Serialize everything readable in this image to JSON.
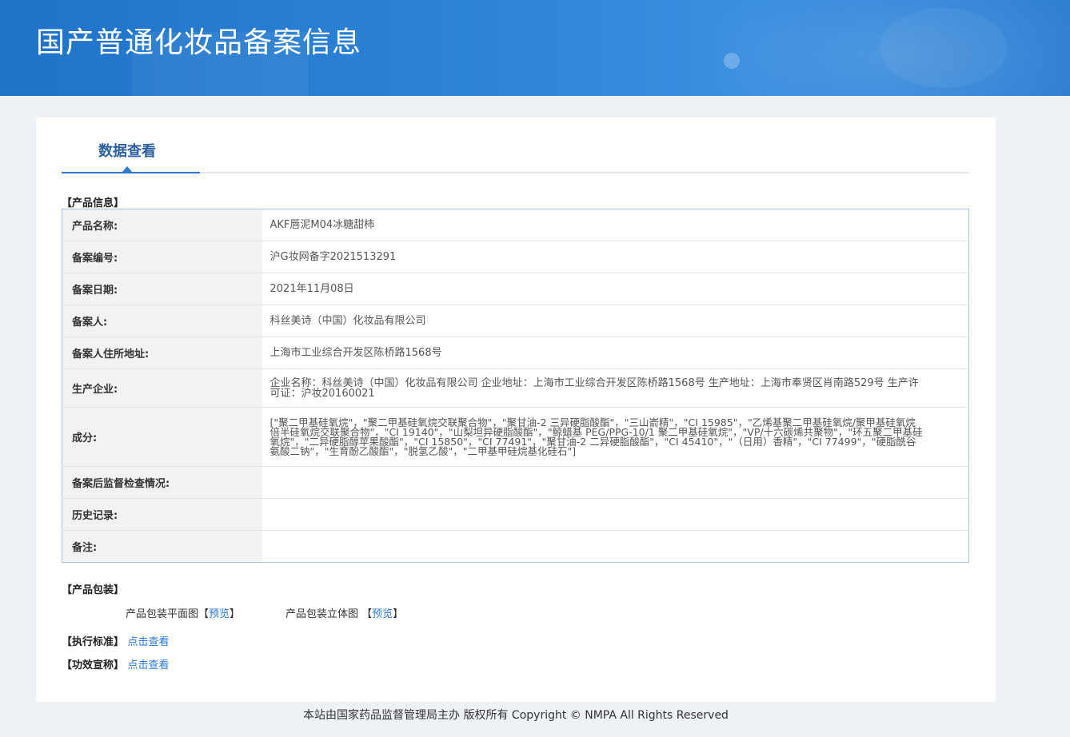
{
  "header": {
    "title": "国产普通化妆品备案信息"
  },
  "tab": {
    "label": "数据查看"
  },
  "product_info": {
    "section_title": "【产品信息】",
    "rows": [
      {
        "label": "产品名称:",
        "value": "AKF唇泥M04冰糖甜柿"
      },
      {
        "label": "备案编号:",
        "value": "沪G妆网备字2021513291"
      },
      {
        "label": "备案日期:",
        "value": "2021年11月08日"
      },
      {
        "label": "备案人:",
        "value": "科丝美诗（中国）化妆品有限公司"
      },
      {
        "label": "备案人住所地址:",
        "value": "上海市工业综合开发区陈桥路1568号"
      },
      {
        "label": "生产企业:",
        "value": "企业名称：科丝美诗（中国）化妆品有限公司 企业地址：上海市工业综合开发区陈桥路1568号 生产地址：上海市奉贤区肖南路529号 生产许可证：沪妆20160021"
      },
      {
        "label": "成分:",
        "value": "[\"聚二甲基硅氧烷\"，\"聚二甲基硅氧烷交联聚合物\"，\"聚甘油-2 三异硬脂酸酯\"，\"三山嵛精\"，\"CI 15985\"，\"乙烯基聚二甲基硅氧烷/聚甲基硅氧烷倍半硅氧烷交联聚合物\"，\"CI 19140\"，\"山梨坦异硬脂酸酯\"，\"鲸蜡基 PEG/PPG-10/1 聚二甲基硅氧烷\"，\"VP/十六碳烯共聚物\"，\"环五聚二甲基硅氧烷\"，\"二异硬脂醇苹果酸酯\"，\"CI 15850\"，\"CI 77491\"，\"聚甘油-2 二异硬脂酸酯\"，\"CI 45410\"，\"（日用）香精\"，\"CI 77499\"，\"硬脂酰谷氨酸二钠\"，\"生育酚乙酸酯\"，\"脱氢乙酸\"，\"二甲基甲硅烷基化硅石\"]"
      },
      {
        "label": "备案后监督检查情况:",
        "value": ""
      },
      {
        "label": "历史记录:",
        "value": ""
      },
      {
        "label": "备注:",
        "value": ""
      }
    ]
  },
  "packaging": {
    "section_title": "【产品包装】",
    "flat_label": "产品包装平面图",
    "stereo_label": "产品包装立体图",
    "preview_text": "预览",
    "bracket_open": "【",
    "bracket_close": "】"
  },
  "standard": {
    "label": "【执行标准】",
    "link": "点击查看"
  },
  "claims": {
    "label": "【功效宣称】",
    "link": "点击查看"
  },
  "footer": {
    "text": "本站由国家药品监督管理局主办 版权所有 Copyright © NMPA All Rights Reserved"
  }
}
